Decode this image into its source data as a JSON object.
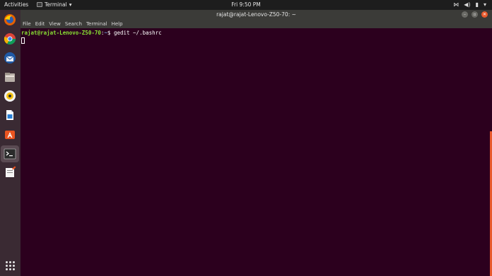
{
  "topbar": {
    "activities": "Activities",
    "app_name": "Terminal",
    "clock": "Fri 9:50 PM",
    "tray": {
      "network": "⋯",
      "volume": "🔊",
      "power": "🔋",
      "menu": "▾"
    }
  },
  "dock": {
    "items": [
      "firefox",
      "chrome",
      "thunderbird",
      "files",
      "rhythmbox",
      "libreoffice-writer",
      "software-center",
      "terminal",
      "text-editor",
      "show-applications"
    ]
  },
  "window": {
    "title": "rajat@rajat-Lenovo-Z50-70: ~",
    "menu": [
      "File",
      "Edit",
      "View",
      "Search",
      "Terminal",
      "Help"
    ],
    "terminal": {
      "prompt_user": "rajat@rajat-Lenovo-Z50-70",
      "prompt_sep": ":",
      "prompt_path": "~",
      "prompt_symbol": "$",
      "command": " gedit ~/.bashrc"
    },
    "colors": {
      "background": "#2c001e",
      "accent": "#e8592c"
    }
  }
}
